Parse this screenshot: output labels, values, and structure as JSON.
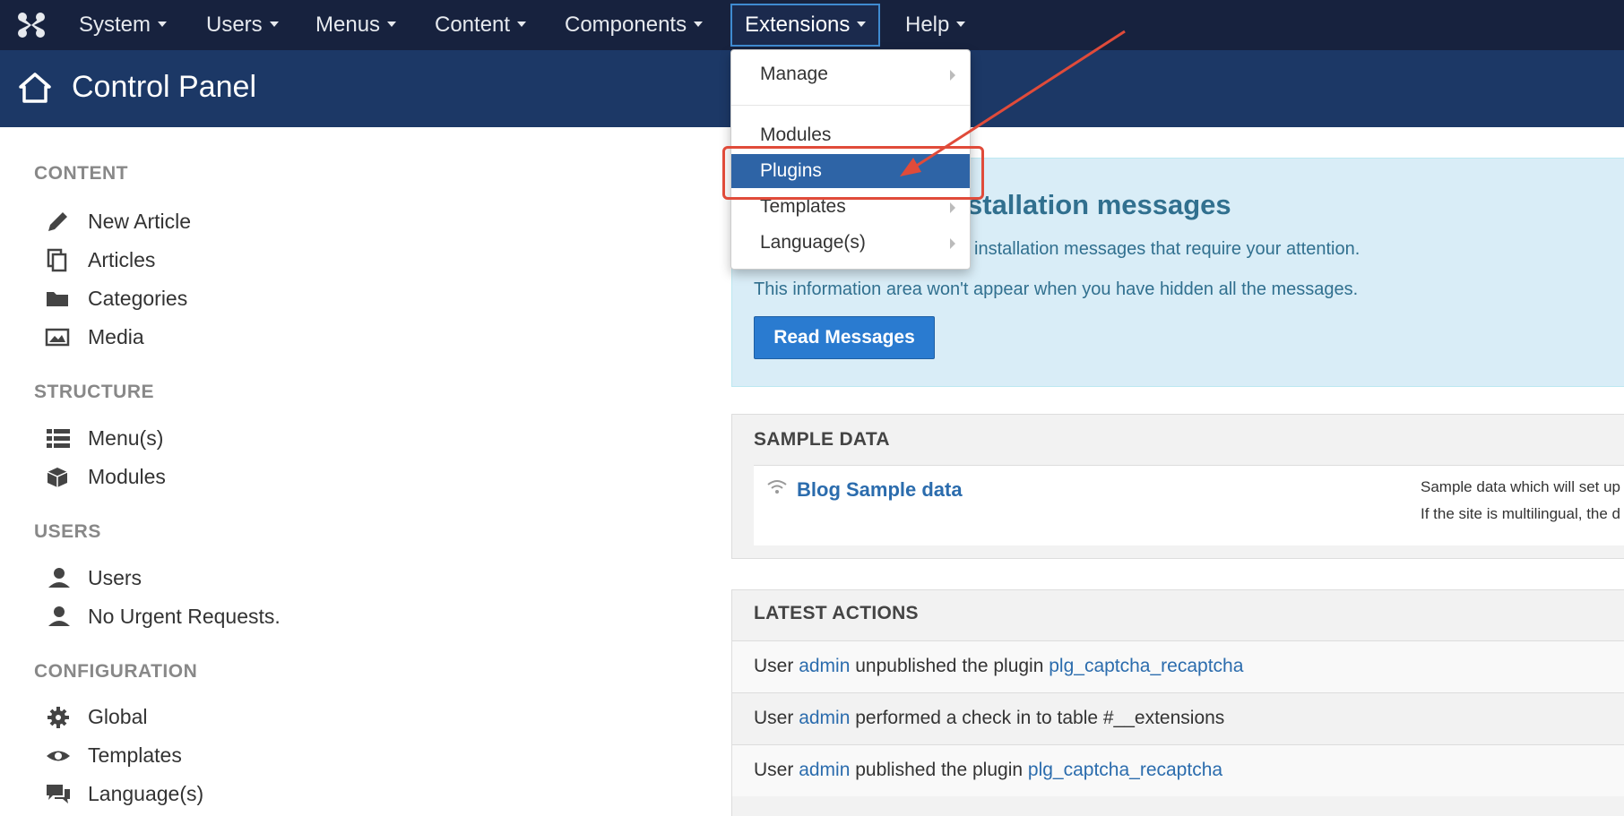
{
  "navbar": {
    "items": [
      {
        "label": "System"
      },
      {
        "label": "Users"
      },
      {
        "label": "Menus"
      },
      {
        "label": "Content"
      },
      {
        "label": "Components"
      },
      {
        "label": "Extensions"
      },
      {
        "label": "Help"
      }
    ],
    "active": "Extensions"
  },
  "header": {
    "title": "Control Panel"
  },
  "sidebar": {
    "content": {
      "heading": "CONTENT",
      "items": [
        {
          "label": "New Article",
          "icon": "pencil-icon"
        },
        {
          "label": "Articles",
          "icon": "copy-icon"
        },
        {
          "label": "Categories",
          "icon": "folder-icon"
        },
        {
          "label": "Media",
          "icon": "image-icon"
        }
      ]
    },
    "structure": {
      "heading": "STRUCTURE",
      "items": [
        {
          "label": "Menu(s)",
          "icon": "list-icon"
        },
        {
          "label": "Modules",
          "icon": "cube-icon"
        }
      ]
    },
    "users": {
      "heading": "USERS",
      "items": [
        {
          "label": "Users",
          "icon": "user-icon"
        },
        {
          "label": "No Urgent Requests.",
          "icon": "user-icon"
        }
      ]
    },
    "configuration": {
      "heading": "CONFIGURATION",
      "items": [
        {
          "label": "Global",
          "icon": "gear-icon"
        },
        {
          "label": "Templates",
          "icon": "eye-icon"
        },
        {
          "label": "Language(s)",
          "icon": "comments-icon"
        }
      ]
    }
  },
  "dropdown": {
    "items": [
      {
        "label": "Manage",
        "has_submenu": true
      },
      {
        "label": "Modules",
        "has_submenu": false
      },
      {
        "label": "Plugins",
        "has_submenu": false,
        "highlighted": true
      },
      {
        "label": "Templates",
        "has_submenu": true
      },
      {
        "label": "Language(s)",
        "has_submenu": true
      }
    ]
  },
  "alert": {
    "title_visible": "stallation messages",
    "line1_visible": "installation messages that require your attention.",
    "line2": "This information area won't appear when you have hidden all the messages.",
    "button": "Read Messages"
  },
  "sample_data": {
    "heading": "SAMPLE DATA",
    "link": "Blog Sample data",
    "desc1": "Sample data which will set up",
    "desc2": "If the site is multilingual, the d"
  },
  "latest_actions": {
    "heading": "LATEST ACTIONS",
    "rows": [
      {
        "prefix": "User ",
        "user": "admin",
        "middle": " unpublished the plugin ",
        "target": "plg_captcha_recaptcha"
      },
      {
        "prefix": "User ",
        "user": "admin",
        "middle": " performed a check in to table #__extensions",
        "target": ""
      },
      {
        "prefix": "User ",
        "user": "admin",
        "middle": " published the plugin ",
        "target": "plg_captcha_recaptcha"
      }
    ]
  },
  "colors": {
    "navbar": "#17223e",
    "subheader": "#1c3866",
    "dropdown_highlight": "#2e64a6",
    "annotation": "#e04b3a",
    "alert_bg": "#d9edf7",
    "primary_button": "#2a7bd0"
  }
}
